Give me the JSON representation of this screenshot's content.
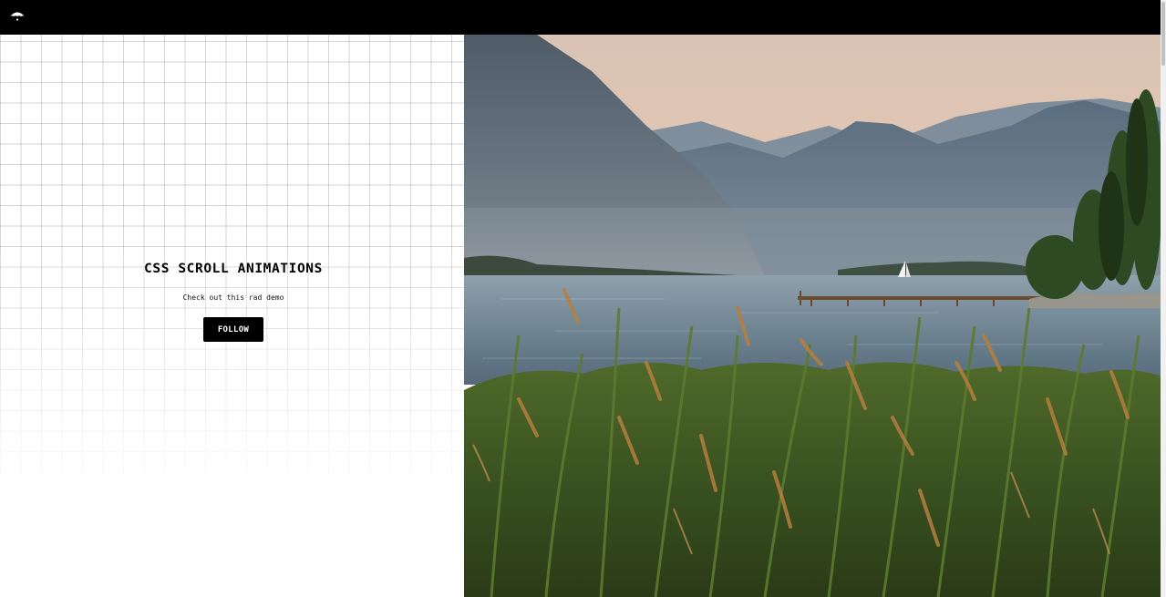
{
  "header": {
    "logo_icon": "umbrella-logo-icon"
  },
  "hero": {
    "title": "CSS SCROLL ANIMATIONS",
    "subtitle": "Check out this rad demo",
    "button_label": "FOLLOW"
  },
  "image": {
    "alt": "Lake landscape with mountains, a wooden pier, a sailboat and tall reeds in the foreground"
  },
  "colors": {
    "topbar": "#000000",
    "button_bg": "#000000",
    "button_text": "#ffffff",
    "page_bg": "#ffffff"
  }
}
